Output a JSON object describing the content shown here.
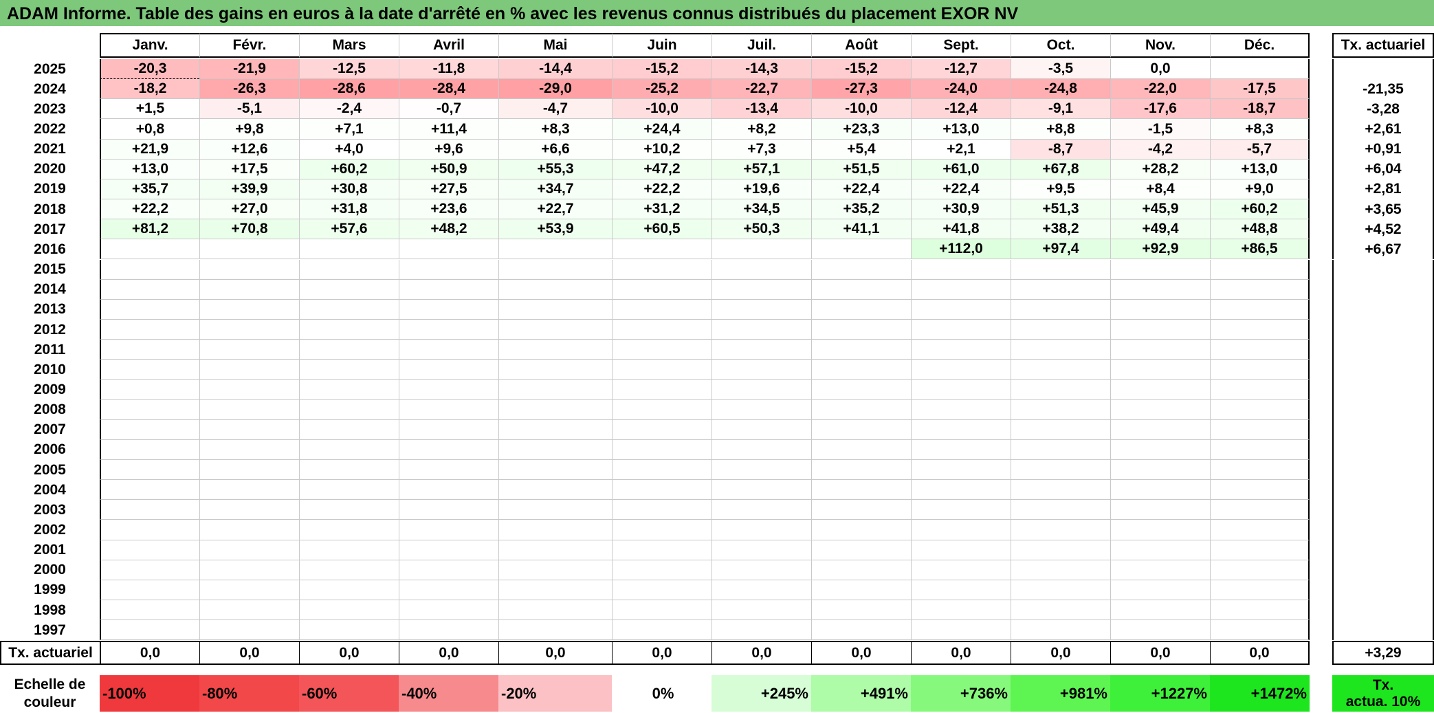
{
  "title": "ADAM Informe. Table des gains en euros à la date d'arrêté en % avec les revenus connus distribués du placement EXOR NV",
  "months": [
    "Janv.",
    "Févr.",
    "Mars",
    "Avril",
    "Mai",
    "Juin",
    "Juil.",
    "Août",
    "Sept.",
    "Oct.",
    "Nov.",
    "Déc."
  ],
  "rate_header": "Tx. actuariel",
  "rows": [
    {
      "year": "2025",
      "values": [
        "-20,3",
        "-21,9",
        "-12,5",
        "-11,8",
        "-14,4",
        "-15,2",
        "-14,3",
        "-15,2",
        "-12,7",
        "-3,5",
        "0,0",
        ""
      ],
      "rate": ""
    },
    {
      "year": "2024",
      "values": [
        "-18,2",
        "-26,3",
        "-28,6",
        "-28,4",
        "-29,0",
        "-25,2",
        "-22,7",
        "-27,3",
        "-24,0",
        "-24,8",
        "-22,0",
        "-17,5"
      ],
      "rate": "-21,35"
    },
    {
      "year": "2023",
      "values": [
        "+1,5",
        "-5,1",
        "-2,4",
        "-0,7",
        "-4,7",
        "-10,0",
        "-13,4",
        "-10,0",
        "-12,4",
        "-9,1",
        "-17,6",
        "-18,7"
      ],
      "rate": "-3,28"
    },
    {
      "year": "2022",
      "values": [
        "+0,8",
        "+9,8",
        "+7,1",
        "+11,4",
        "+8,3",
        "+24,4",
        "+8,2",
        "+23,3",
        "+13,0",
        "+8,8",
        "-1,5",
        "+8,3"
      ],
      "rate": "+2,61"
    },
    {
      "year": "2021",
      "values": [
        "+21,9",
        "+12,6",
        "+4,0",
        "+9,6",
        "+6,6",
        "+10,2",
        "+7,3",
        "+5,4",
        "+2,1",
        "-8,7",
        "-4,2",
        "-5,7"
      ],
      "rate": "+0,91"
    },
    {
      "year": "2020",
      "values": [
        "+13,0",
        "+17,5",
        "+60,2",
        "+50,9",
        "+55,3",
        "+47,2",
        "+57,1",
        "+51,5",
        "+61,0",
        "+67,8",
        "+28,2",
        "+13,0"
      ],
      "rate": "+6,04"
    },
    {
      "year": "2019",
      "values": [
        "+35,7",
        "+39,9",
        "+30,8",
        "+27,5",
        "+34,7",
        "+22,2",
        "+19,6",
        "+22,4",
        "+22,4",
        "+9,5",
        "+8,4",
        "+9,0"
      ],
      "rate": "+2,81"
    },
    {
      "year": "2018",
      "values": [
        "+22,2",
        "+27,0",
        "+31,8",
        "+23,6",
        "+22,7",
        "+31,2",
        "+34,5",
        "+35,2",
        "+30,9",
        "+51,3",
        "+45,9",
        "+60,2"
      ],
      "rate": "+3,65"
    },
    {
      "year": "2017",
      "values": [
        "+81,2",
        "+70,8",
        "+57,6",
        "+48,2",
        "+53,9",
        "+60,5",
        "+50,3",
        "+41,1",
        "+41,8",
        "+38,2",
        "+49,4",
        "+48,8"
      ],
      "rate": "+4,52"
    },
    {
      "year": "2016",
      "values": [
        "",
        "",
        "",
        "",
        "",
        "",
        "",
        "",
        "+112,0",
        "+97,4",
        "+92,9",
        "+86,5"
      ],
      "rate": "+6,67"
    },
    {
      "year": "2015",
      "values": [
        "",
        "",
        "",
        "",
        "",
        "",
        "",
        "",
        "",
        "",
        "",
        ""
      ],
      "rate": ""
    },
    {
      "year": "2014",
      "values": [
        "",
        "",
        "",
        "",
        "",
        "",
        "",
        "",
        "",
        "",
        "",
        ""
      ],
      "rate": ""
    },
    {
      "year": "2013",
      "values": [
        "",
        "",
        "",
        "",
        "",
        "",
        "",
        "",
        "",
        "",
        "",
        ""
      ],
      "rate": ""
    },
    {
      "year": "2012",
      "values": [
        "",
        "",
        "",
        "",
        "",
        "",
        "",
        "",
        "",
        "",
        "",
        ""
      ],
      "rate": ""
    },
    {
      "year": "2011",
      "values": [
        "",
        "",
        "",
        "",
        "",
        "",
        "",
        "",
        "",
        "",
        "",
        ""
      ],
      "rate": ""
    },
    {
      "year": "2010",
      "values": [
        "",
        "",
        "",
        "",
        "",
        "",
        "",
        "",
        "",
        "",
        "",
        ""
      ],
      "rate": ""
    },
    {
      "year": "2009",
      "values": [
        "",
        "",
        "",
        "",
        "",
        "",
        "",
        "",
        "",
        "",
        "",
        ""
      ],
      "rate": ""
    },
    {
      "year": "2008",
      "values": [
        "",
        "",
        "",
        "",
        "",
        "",
        "",
        "",
        "",
        "",
        "",
        ""
      ],
      "rate": ""
    },
    {
      "year": "2007",
      "values": [
        "",
        "",
        "",
        "",
        "",
        "",
        "",
        "",
        "",
        "",
        "",
        ""
      ],
      "rate": ""
    },
    {
      "year": "2006",
      "values": [
        "",
        "",
        "",
        "",
        "",
        "",
        "",
        "",
        "",
        "",
        "",
        ""
      ],
      "rate": ""
    },
    {
      "year": "2005",
      "values": [
        "",
        "",
        "",
        "",
        "",
        "",
        "",
        "",
        "",
        "",
        "",
        ""
      ],
      "rate": ""
    },
    {
      "year": "2004",
      "values": [
        "",
        "",
        "",
        "",
        "",
        "",
        "",
        "",
        "",
        "",
        "",
        ""
      ],
      "rate": ""
    },
    {
      "year": "2003",
      "values": [
        "",
        "",
        "",
        "",
        "",
        "",
        "",
        "",
        "",
        "",
        "",
        ""
      ],
      "rate": ""
    },
    {
      "year": "2002",
      "values": [
        "",
        "",
        "",
        "",
        "",
        "",
        "",
        "",
        "",
        "",
        "",
        ""
      ],
      "rate": ""
    },
    {
      "year": "2001",
      "values": [
        "",
        "",
        "",
        "",
        "",
        "",
        "",
        "",
        "",
        "",
        "",
        ""
      ],
      "rate": ""
    },
    {
      "year": "2000",
      "values": [
        "",
        "",
        "",
        "",
        "",
        "",
        "",
        "",
        "",
        "",
        "",
        ""
      ],
      "rate": ""
    },
    {
      "year": "1999",
      "values": [
        "",
        "",
        "",
        "",
        "",
        "",
        "",
        "",
        "",
        "",
        "",
        ""
      ],
      "rate": ""
    },
    {
      "year": "1998",
      "values": [
        "",
        "",
        "",
        "",
        "",
        "",
        "",
        "",
        "",
        "",
        "",
        ""
      ],
      "rate": ""
    },
    {
      "year": "1997",
      "values": [
        "",
        "",
        "",
        "",
        "",
        "",
        "",
        "",
        "",
        "",
        "",
        ""
      ],
      "rate": ""
    }
  ],
  "footer": {
    "label": "Tx. actuariel",
    "values": [
      "0,0",
      "0,0",
      "0,0",
      "0,0",
      "0,0",
      "0,0",
      "0,0",
      "0,0",
      "0,0",
      "0,0",
      "0,0",
      "0,0"
    ],
    "rate": "+3,29"
  },
  "color_scale": {
    "label_line1": "Echelle de",
    "label_line2": "couleur",
    "items": [
      {
        "text": "-100%",
        "color": "#f0393c"
      },
      {
        "text": "-80%",
        "color": "#f2484a"
      },
      {
        "text": "-60%",
        "color": "#f45559"
      },
      {
        "text": "-40%",
        "color": "#f78a8d"
      },
      {
        "text": "-20%",
        "color": "#fbc1c4"
      },
      {
        "text": "0%",
        "color": "#ffffff"
      },
      {
        "text": "+245%",
        "color": "#d6fdd5"
      },
      {
        "text": "+491%",
        "color": "#aefba8"
      },
      {
        "text": "+736%",
        "color": "#86f97c"
      },
      {
        "text": "+981%",
        "color": "#5ef553"
      },
      {
        "text": "+1227%",
        "color": "#3ff03a"
      },
      {
        "text": "+1472%",
        "color": "#1ee61e"
      }
    ],
    "rate_line1": "Tx.",
    "rate_line2": "actua. 10%",
    "rate_color": "#1ee61e"
  },
  "colors": {
    "title_bg": "#7ec87c",
    "grid_line": "#c9c9c9",
    "border": "#000000"
  }
}
